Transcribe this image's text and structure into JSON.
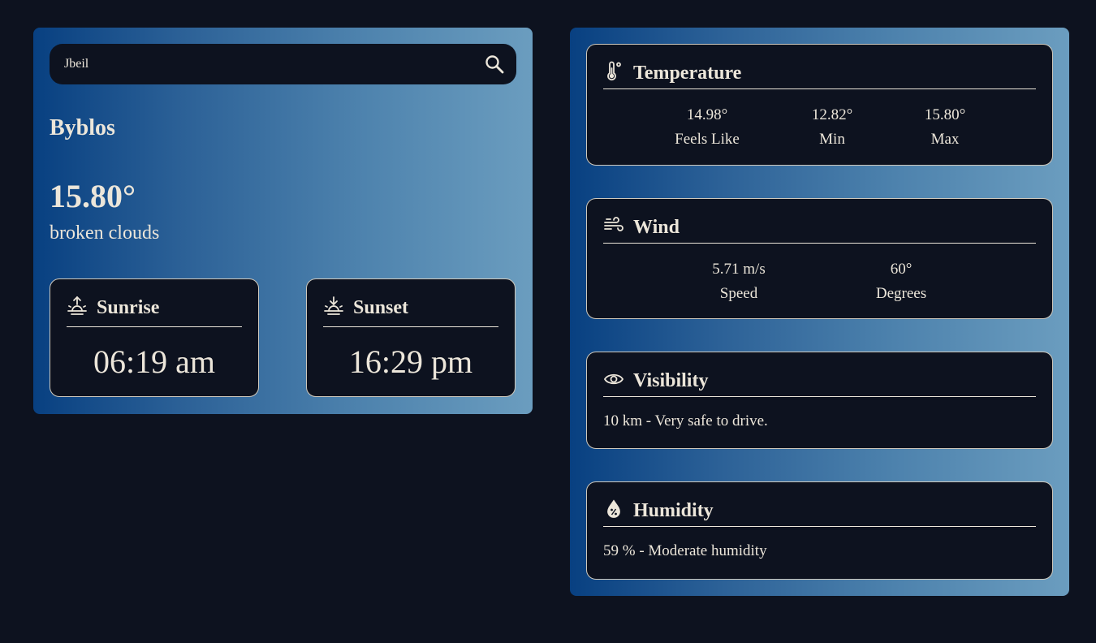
{
  "search": {
    "value": "Jbeil",
    "icon": "search-icon"
  },
  "location": {
    "city": "Byblos",
    "temperature": "15.80°",
    "description": "broken clouds"
  },
  "sunrise": {
    "label": "Sunrise",
    "time": "06:19 am",
    "icon": "sunrise-icon"
  },
  "sunset": {
    "label": "Sunset",
    "time": "16:29 pm",
    "icon": "sunset-icon"
  },
  "temperature_card": {
    "title": "Temperature",
    "icon": "thermometer-icon",
    "stats": [
      {
        "value": "14.98°",
        "label": "Feels Like"
      },
      {
        "value": "12.82°",
        "label": "Min"
      },
      {
        "value": "15.80°",
        "label": "Max"
      }
    ]
  },
  "wind_card": {
    "title": "Wind",
    "icon": "wind-icon",
    "stats": [
      {
        "value": "5.71 m/s",
        "label": "Speed"
      },
      {
        "value": "60°",
        "label": "Degrees"
      }
    ]
  },
  "visibility_card": {
    "title": "Visibility",
    "icon": "eye-icon",
    "text": "10 km - Very safe to drive."
  },
  "humidity_card": {
    "title": "Humidity",
    "icon": "humidity-icon",
    "text": "59 % - Moderate humidity"
  },
  "colors": {
    "background": "#0d121f",
    "gradient_start": "#084081",
    "gradient_end": "#6b9dbf",
    "text": "#ece6da"
  }
}
